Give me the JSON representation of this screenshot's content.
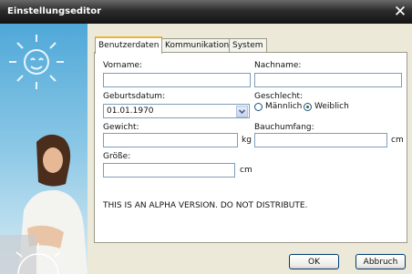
{
  "window": {
    "title": "Einstellungseditor",
    "close_glyph": "✕"
  },
  "tabs": [
    {
      "label": "Benutzerdaten",
      "active": true
    },
    {
      "label": "Kommunikation",
      "active": false
    },
    {
      "label": "System",
      "active": false
    }
  ],
  "form": {
    "vorname_label": "Vorname:",
    "vorname_value": "",
    "nachname_label": "Nachname:",
    "nachname_value": "",
    "geburtsdatum_label": "Geburtsdatum:",
    "geburtsdatum_value": "01.01.1970",
    "geschlecht_label": "Geschlecht:",
    "geschlecht_options": [
      {
        "label": "Männlich",
        "selected": false
      },
      {
        "label": "Weiblich",
        "selected": true
      }
    ],
    "gewicht_label": "Gewicht:",
    "gewicht_value": "",
    "gewicht_unit": "kg",
    "bauchumfang_label": "Bauchumfang:",
    "bauchumfang_value": "",
    "bauchumfang_unit": "cm",
    "groesse_label": "Größe:",
    "groesse_value": "",
    "groesse_unit": "cm"
  },
  "notice": "THIS IS AN ALPHA VERSION. DO NOT DISTRIBUTE.",
  "buttons": {
    "ok": "OK",
    "cancel": "Abbruch"
  },
  "icons": [
    "close-icon",
    "dropdown-arrow-icon"
  ],
  "colors": {
    "titlebar": "#1e1e1e",
    "accent_tab": "#f0b040",
    "field_border": "#7f9db9",
    "background": "#ece9d8"
  }
}
